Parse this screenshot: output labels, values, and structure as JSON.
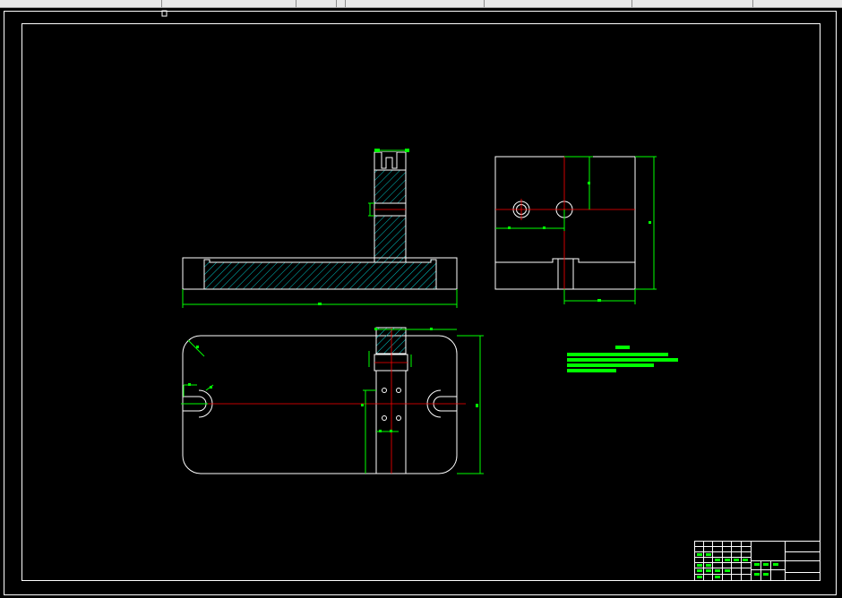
{
  "window": {
    "toolbar_separators": 7
  },
  "colors": {
    "background": "#000000",
    "outline": "#ffffff",
    "dimension": "#00ff00",
    "centerline": "#ff0000",
    "hatch": "#00c8c8",
    "toolbar": "#e9e9e9"
  },
  "drawing": {
    "views": [
      "front-section-view",
      "side-view",
      "top-view"
    ],
    "technical_notes_lines": 4,
    "title_block": {
      "left_grid_columns": 6,
      "left_grid_rows": 7
    }
  }
}
